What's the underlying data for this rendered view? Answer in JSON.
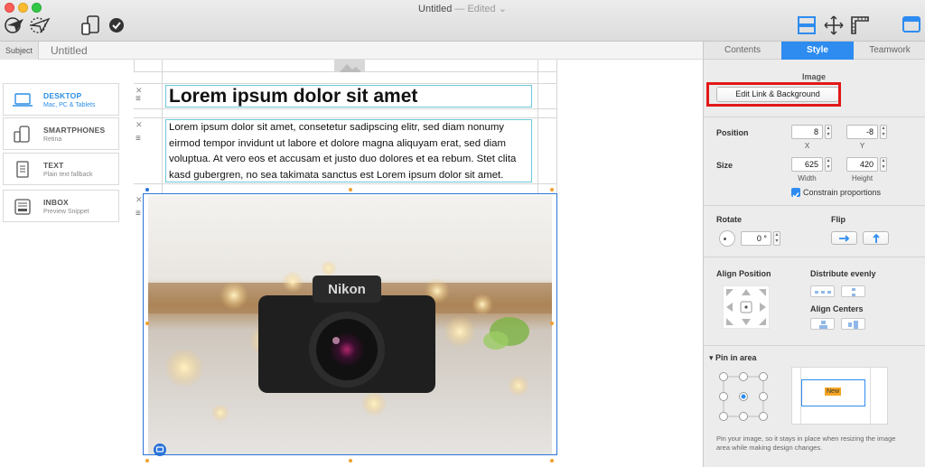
{
  "window": {
    "title": "Untitled",
    "status": "— Edited",
    "chevron": "⌄"
  },
  "toolbar": {
    "icons": [
      "send-plane-icon",
      "send-test-icon",
      "devices-icon",
      "checkmark-circle-icon",
      "layout-grid-icon",
      "move-crosshair-icon",
      "ruler-icon",
      "window-pane-icon"
    ]
  },
  "subject": {
    "label": "Subject",
    "placeholder": "Untitled"
  },
  "devices": [
    {
      "name": "DESKTOP",
      "sub": "Mac, PC & Tablets",
      "icon": "laptop-icon",
      "active": true
    },
    {
      "name": "SMARTPHONES",
      "sub": "Retina",
      "icon": "smartphone-icon",
      "active": false
    },
    {
      "name": "TEXT",
      "sub": "Plain text fallback",
      "icon": "text-doc-icon",
      "active": false
    },
    {
      "name": "INBOX",
      "sub": "Preview Snippet",
      "icon": "inbox-icon",
      "active": false
    }
  ],
  "content": {
    "heading": "Lorem ipsum dolor sit amet",
    "paragraph": "Lorem ipsum dolor sit amet, consetetur sadipscing elitr, sed diam nonumy eirmod tempor invidunt ut labore et dolore magna aliquyam erat, sed diam voluptua. At vero eos et accusam et justo duo dolores et ea rebum. Stet clita kasd gubergren, no sea takimata sanctus est Lorem ipsum dolor sit amet.",
    "row_close": "✕",
    "row_handle": "≡",
    "camera_brand": "Nikon"
  },
  "panel": {
    "tabs": [
      "Contents",
      "Style",
      "Teamwork"
    ],
    "active_tab": "Style",
    "section": "Image",
    "edit_button": "Edit Link & Background",
    "position": {
      "label": "Position",
      "x": "8",
      "y": "-8",
      "x_label": "X",
      "y_label": "Y"
    },
    "size": {
      "label": "Size",
      "width": "625",
      "height": "420",
      "width_label": "Width",
      "height_label": "Height"
    },
    "constrain": {
      "label": "Constrain proportions",
      "checked": true
    },
    "rotate": {
      "label": "Rotate",
      "value": "0 °"
    },
    "flip": {
      "label": "Flip"
    },
    "align_position": "Align Position",
    "distribute": "Distribute evenly",
    "align_centers": "Align Centers",
    "pin": {
      "label": "Pin in area",
      "badge": "New"
    },
    "help": "Pin your image, so it stays in place when resizing the image area while making design changes."
  },
  "colors": {
    "accent": "#2e8cf0",
    "highlight": "#e21818",
    "guide": "#6cc9d9",
    "handle": "#f0a030"
  }
}
